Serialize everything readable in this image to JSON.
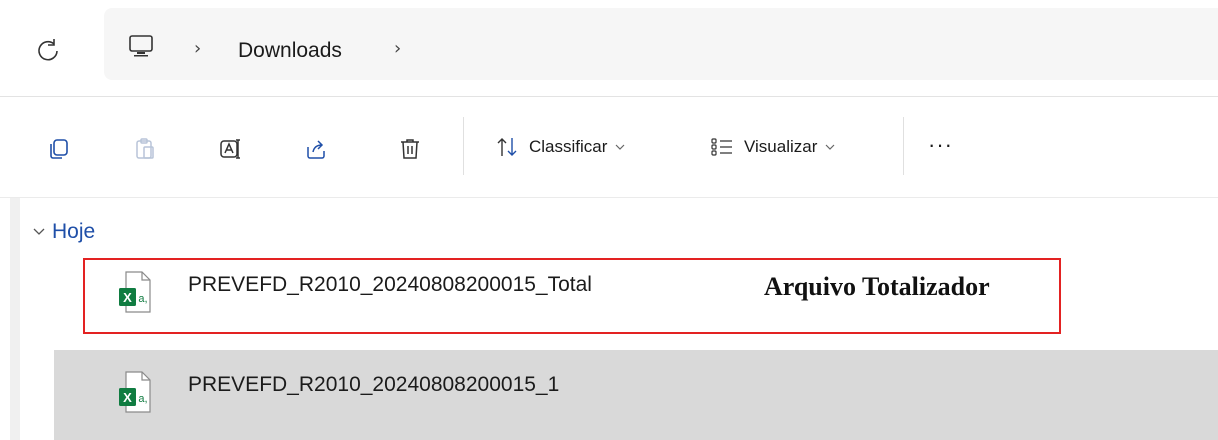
{
  "address_bar": {
    "breadcrumb": [
      {
        "label": "Downloads"
      }
    ],
    "icons": {
      "refresh": "refresh-icon",
      "location": "this-pc-icon"
    }
  },
  "toolbar": {
    "icons": [
      "copy-icon",
      "paste-icon",
      "rename-icon",
      "share-icon",
      "delete-icon"
    ],
    "sort_label": "Classificar",
    "view_label": "Visualizar",
    "more_label": "···"
  },
  "content": {
    "group": {
      "label": "Hoje",
      "expanded": true
    },
    "files": [
      {
        "name": "PREVEFD_R2010_20240808200015_Total",
        "type": "excel-csv-icon",
        "selected": false
      },
      {
        "name": "PREVEFD_R2010_20240808200015_1",
        "type": "excel-csv-icon",
        "selected": true
      }
    ]
  },
  "annotation": {
    "text": "Arquivo Totalizador",
    "color": "#e32222"
  },
  "colors": {
    "accent_group": "#1f4fa8",
    "selected_row": "#d9d9d9",
    "excel_green": "#107c41"
  }
}
